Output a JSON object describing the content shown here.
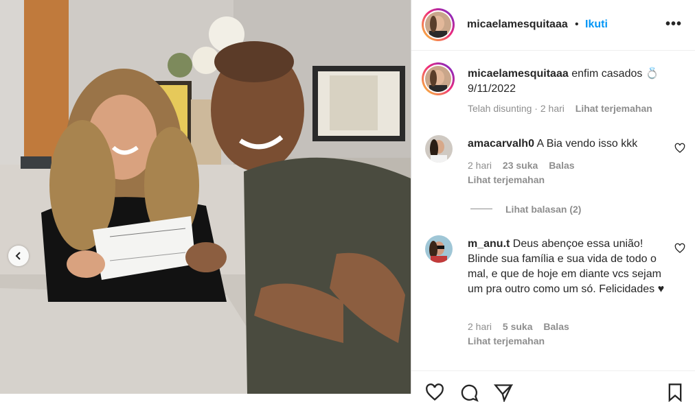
{
  "post": {
    "username": "micaelamesquitaaa",
    "separator": "•",
    "follow_label": "Ikuti",
    "more_label": "•••"
  },
  "caption": {
    "username": "micaelamesquitaaa",
    "text": "enfim casados 💍 9/11/2022",
    "edited": "Telah disunting",
    "time": "2 hari",
    "translate": "Lihat terjemahan"
  },
  "comments": [
    {
      "username": "amacarvalh0",
      "text": "A Bia vendo isso kkk",
      "time": "2 hari",
      "likes": "23 suka",
      "reply": "Balas",
      "translate": "Lihat terjemahan",
      "replies": "Lihat balasan (2)"
    },
    {
      "username": "m_anu.t",
      "text": "Deus abençoe essa união! Blinde sua família e sua vida de todo o mal, e que de hoje em diante vcs sejam um pra outro como um só. Felicidades ♥",
      "time": "2 hari",
      "likes": "5 suka",
      "reply": "Balas",
      "translate": "Lihat terjemahan"
    }
  ],
  "icons": {
    "prev": "chevron-left-icon",
    "heart": "heart-icon",
    "comment": "comment-icon",
    "share": "share-icon",
    "save": "bookmark-icon"
  },
  "colors": {
    "follow": "#0095f6",
    "text": "#262626",
    "muted": "#8e8e8e"
  }
}
